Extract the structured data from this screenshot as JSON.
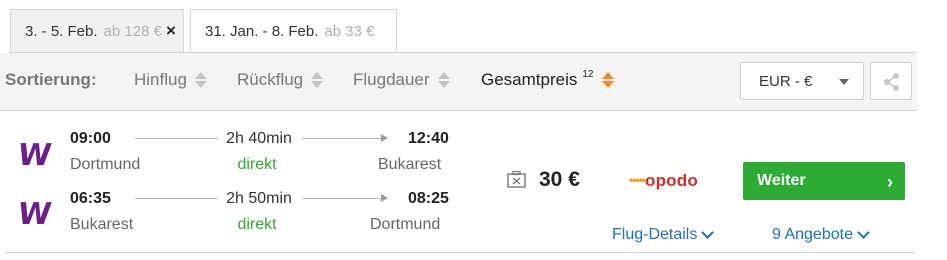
{
  "tabs": [
    {
      "dates": "3. - 5. Feb.",
      "price": "ab 128 €",
      "close_icon": "×"
    },
    {
      "dates": "31. Jan. - 8. Feb.",
      "price": "ab 33 €"
    }
  ],
  "sort": {
    "label": "Sortierung:",
    "options": [
      "Hinflug",
      "Rückflug",
      "Flugdauer",
      "Gesamtpreis"
    ],
    "active_superscript": "12"
  },
  "currency": {
    "value": "EUR - €"
  },
  "result": {
    "outbound": {
      "airline_logo": "W",
      "depart_time": "09:00",
      "depart_city": "Dortmund",
      "duration": "2h 40min",
      "stops": "direkt",
      "arrive_time": "12:40",
      "arrive_city": "Bukarest"
    },
    "inbound": {
      "airline_logo": "W",
      "depart_time": "06:35",
      "depart_city": "Bukarest",
      "duration": "2h 50min",
      "stops": "direkt",
      "arrive_time": "08:25",
      "arrive_city": "Dortmund"
    },
    "price": "30 €",
    "provider": {
      "dots": "•••••",
      "name": "opodo"
    },
    "cta": "Weiter",
    "cta_chevron": "›",
    "details_link": "Flug-Details",
    "offers_link": "9 Angebote"
  },
  "colors": {
    "accent_green": "#2dab35",
    "link_blue": "#1d6fbf",
    "sort_orange": "#f08b25",
    "airline_purple": "#6a1f8a",
    "direct_green": "#3aa23a"
  },
  "icons": [
    "close-icon",
    "sort-arrows-icon",
    "caret-down-icon",
    "share-icon",
    "baggage-icon",
    "chevron-right-icon",
    "chevron-down-icon"
  ]
}
